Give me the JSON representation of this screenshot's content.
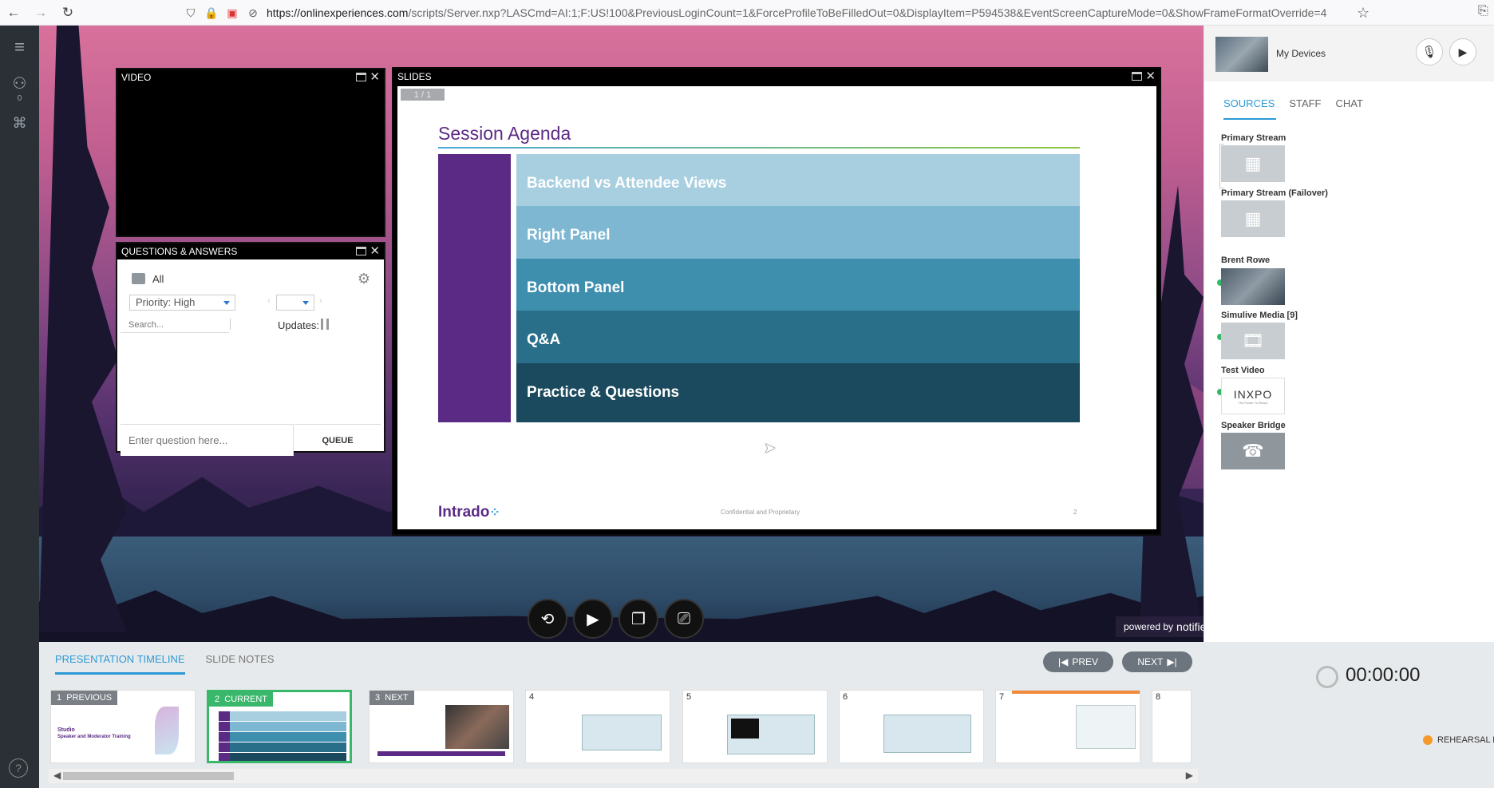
{
  "browser": {
    "url_host": "https://onlinexperiences.com",
    "url_path": "/scripts/Server.nxp?LASCmd=AI:1;F:US!100&PreviousLoginCount=1&ForceProfileToBeFilledOut=0&DisplayItem=P594538&EventScreenCaptureMode=0&ShowFrameFormatOverride=4"
  },
  "left_rail": {
    "users_count": "0"
  },
  "video": {
    "title": "VIDEO"
  },
  "qa": {
    "title": "QUESTIONS & ANSWERS",
    "folder_label": "All",
    "priority_select": "Priority: High",
    "search_placeholder": "Search...",
    "updates_label": "Updates:",
    "question_placeholder": "Enter question here...",
    "queue_label": "QUEUE"
  },
  "slides": {
    "title": "SLIDES",
    "counter": "1 / 1",
    "slide_title": "Session Agenda",
    "agenda": [
      {
        "label": "Backend vs Attendee Views",
        "color": "#a8cfe0"
      },
      {
        "label": "Right Panel",
        "color": "#7db7d1"
      },
      {
        "label": "Bottom Panel",
        "color": "#3e8eae"
      },
      {
        "label": "Q&A",
        "color": "#2a6f8a"
      },
      {
        "label": "Practice & Questions",
        "color": "#1b4a5e"
      }
    ],
    "logo": "Intrado",
    "footer": "Confidential and Proprietary",
    "page": "2"
  },
  "powered_by": {
    "prefix": "powered by",
    "brand": "notified"
  },
  "right_panel": {
    "device_title": "My Devices",
    "tabs": [
      "SOURCES",
      "STAFF",
      "CHAT"
    ],
    "sources": [
      {
        "label": "Primary Stream",
        "icon": "broken-image-icon"
      },
      {
        "label": "Primary Stream (Failover)",
        "icon": "broken-image-icon"
      },
      {
        "label": "Brent Rowe",
        "icon": "webcam-thumb"
      },
      {
        "label": "Simulive Media [9]",
        "icon": "film-icon"
      },
      {
        "label": "Test Video",
        "icon": "inxpo-logo"
      },
      {
        "label": "Speaker Bridge",
        "icon": "phone-icon"
      }
    ],
    "inxpo_text": "INXPO",
    "inxpo_sub": "The Power To Reach"
  },
  "bottom": {
    "tabs": [
      "PRESENTATION TIMELINE",
      "SLIDE NOTES"
    ],
    "prev_label": "PREV",
    "next_label": "NEXT",
    "thumbs": [
      {
        "num": "1",
        "badge": "PREVIOUS",
        "caption": "Studio",
        "subcaption": "Speaker and Moderator Training"
      },
      {
        "num": "2",
        "badge": "CURRENT",
        "caption": "",
        "subcaption": ""
      },
      {
        "num": "3",
        "badge": "NEXT",
        "caption": "",
        "subcaption": ""
      },
      {
        "num": "4",
        "badge": "",
        "caption": "",
        "subcaption": ""
      },
      {
        "num": "5",
        "badge": "",
        "caption": "",
        "subcaption": ""
      },
      {
        "num": "6",
        "badge": "",
        "caption": "",
        "subcaption": ""
      },
      {
        "num": "7",
        "badge": "",
        "caption": "",
        "subcaption": ""
      },
      {
        "num": "8",
        "badge": "",
        "caption": "",
        "subcaption": ""
      }
    ]
  },
  "timer": {
    "value": "00:00:00",
    "mode": "REHEARSAL M"
  }
}
